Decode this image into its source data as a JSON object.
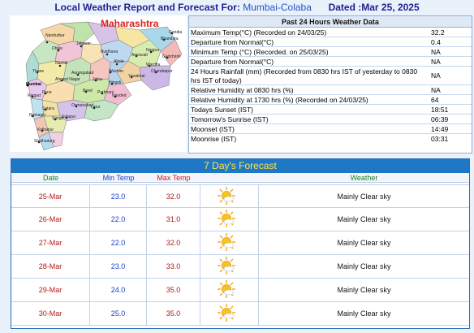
{
  "header": {
    "prefix": "Local Weather Report and Forecast For:",
    "location": "Mumbai-Colaba",
    "dated": "Dated :Mar 25, 2025"
  },
  "map": {
    "title": "Maharashtra",
    "labels": {
      "nandurbar": "Nandurbar",
      "jalgaon": "Jalgaon",
      "buldhana": "Buldhana",
      "dhule": "Dhule",
      "amravati": "Amravati",
      "akola": "Akola",
      "nashik": "Nashik",
      "aurangabad": "Aurangabad",
      "washim": "Washim",
      "jalna": "Jalna",
      "hingoli": "Hingoli",
      "yavatmal": "Yavatmal",
      "nagpur": "Nagpur",
      "bhandara": "Bhandara",
      "gondia": "Gondia",
      "wardha": "Wardha",
      "gadchiroli": "Gadchiroli",
      "chandrapur": "Chandrapur",
      "thane": "Thane",
      "mumbai": "Mumbai",
      "raigad": "Raigad",
      "pune": "Pune",
      "ahmednagar": "Ahmed Nagar",
      "beed": "Beed",
      "parbhani": "Parbhani",
      "nanded": "Nanded",
      "latur": "Latur",
      "osmanabad": "Osmanabad",
      "solapur": "Solapur",
      "satara": "Satara",
      "ratnagiri": "Ratnagiri",
      "sangli": "Sangli",
      "kolhapur": "Kolhapur",
      "sindhudurg": "Sindhudurg"
    }
  },
  "past": {
    "title": "Past 24 Hours Weather Data",
    "rows": [
      {
        "label": "Maximum Temp(°C) (Recorded on 24/03/25)",
        "value": "32.2"
      },
      {
        "label": "Departure from Normal(°C)",
        "value": "0.4"
      },
      {
        "label": "Minimum Temp (°C) (Recorded. on 25/03/25)",
        "value": "NA"
      },
      {
        "label": "Departure from Normal(°C)",
        "value": "NA"
      },
      {
        "label": "24 Hours Rainfall (mm) (Recorded from 0830 hrs IST of yesterday to 0830 hrs IST of today)",
        "value": "NA"
      },
      {
        "label": "Relative Humidity at 0830 hrs (%)",
        "value": "NA"
      },
      {
        "label": "Relative Humidity at 1730 hrs (%) (Recorded on 24/03/25)",
        "value": "64"
      },
      {
        "label": "Todays Sunset (IST)",
        "value": "18:51"
      },
      {
        "label": "Tomorrow's Sunrise (IST)",
        "value": "06:39"
      },
      {
        "label": "Moonset (IST)",
        "value": "14:49"
      },
      {
        "label": "Moonrise (IST)",
        "value": "03:31"
      }
    ]
  },
  "forecast": {
    "title": "7 Day's Forecast",
    "headers": {
      "date": "Date",
      "min": "Min Temp",
      "max": "Max Temp",
      "weather": "Weather"
    },
    "rows": [
      {
        "date": "25-Mar",
        "min": "23.0",
        "max": "32.0",
        "icon": "mainly-clear-sky-icon",
        "weather": "Mainly Clear sky"
      },
      {
        "date": "26-Mar",
        "min": "22.0",
        "max": "31.0",
        "icon": "mainly-clear-sky-icon",
        "weather": "Mainly Clear sky"
      },
      {
        "date": "27-Mar",
        "min": "22.0",
        "max": "32.0",
        "icon": "mainly-clear-sky-icon",
        "weather": "Mainly Clear sky"
      },
      {
        "date": "28-Mar",
        "min": "23.0",
        "max": "33.0",
        "icon": "mainly-clear-sky-icon",
        "weather": "Mainly Clear sky"
      },
      {
        "date": "29-Mar",
        "min": "24.0",
        "max": "35.0",
        "icon": "mainly-clear-sky-icon",
        "weather": "Mainly Clear sky"
      },
      {
        "date": "30-Mar",
        "min": "25.0",
        "max": "35.0",
        "icon": "mainly-clear-sky-icon",
        "weather": "Mainly Clear sky"
      }
    ]
  },
  "colors": {
    "forecast_title_bg": "#1e78c6",
    "forecast_title_text": "#ffe34a",
    "date_text": "#b21a1a",
    "min_text": "#1c3fbf",
    "max_text": "#b21a1a"
  }
}
